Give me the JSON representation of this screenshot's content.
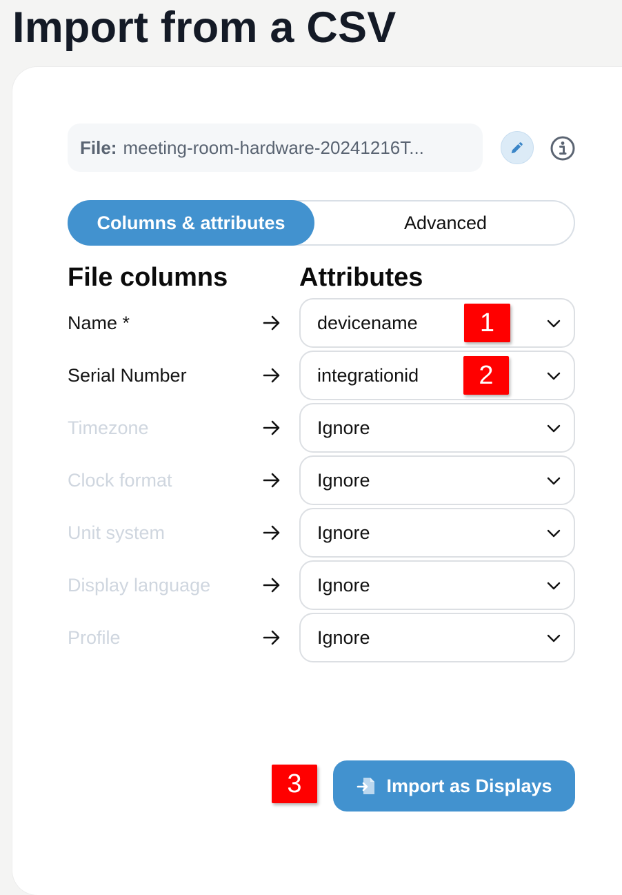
{
  "page": {
    "title": "Import from a CSV"
  },
  "file": {
    "label": "File:",
    "name": "meeting-room-hardware-20241216T..."
  },
  "tabs": [
    {
      "label": "Columns & attributes",
      "active": true
    },
    {
      "label": "Advanced",
      "active": false
    }
  ],
  "headers": {
    "file_columns": "File columns",
    "attributes": "Attributes"
  },
  "mappings": [
    {
      "column": "Name *",
      "attribute": "devicename",
      "mapped": true
    },
    {
      "column": "Serial Number",
      "attribute": "integrationid",
      "mapped": true
    },
    {
      "column": "Timezone",
      "attribute": "Ignore",
      "mapped": false
    },
    {
      "column": "Clock format",
      "attribute": "Ignore",
      "mapped": false
    },
    {
      "column": "Unit system",
      "attribute": "Ignore",
      "mapped": false
    },
    {
      "column": "Display language",
      "attribute": "Ignore",
      "mapped": false
    },
    {
      "column": "Profile",
      "attribute": "Ignore",
      "mapped": false
    }
  ],
  "markers": [
    "1",
    "2",
    "3"
  ],
  "actions": {
    "import_label": "Import as Displays"
  },
  "colors": {
    "accent": "#4292cf",
    "marker": "#ff0000",
    "ignored_text": "#cfd6df"
  },
  "icons": {
    "edit": "pencil-icon",
    "info": "info-icon",
    "arrow": "arrow-right-icon",
    "chevron": "chevron-down-icon",
    "import": "file-import-icon"
  }
}
